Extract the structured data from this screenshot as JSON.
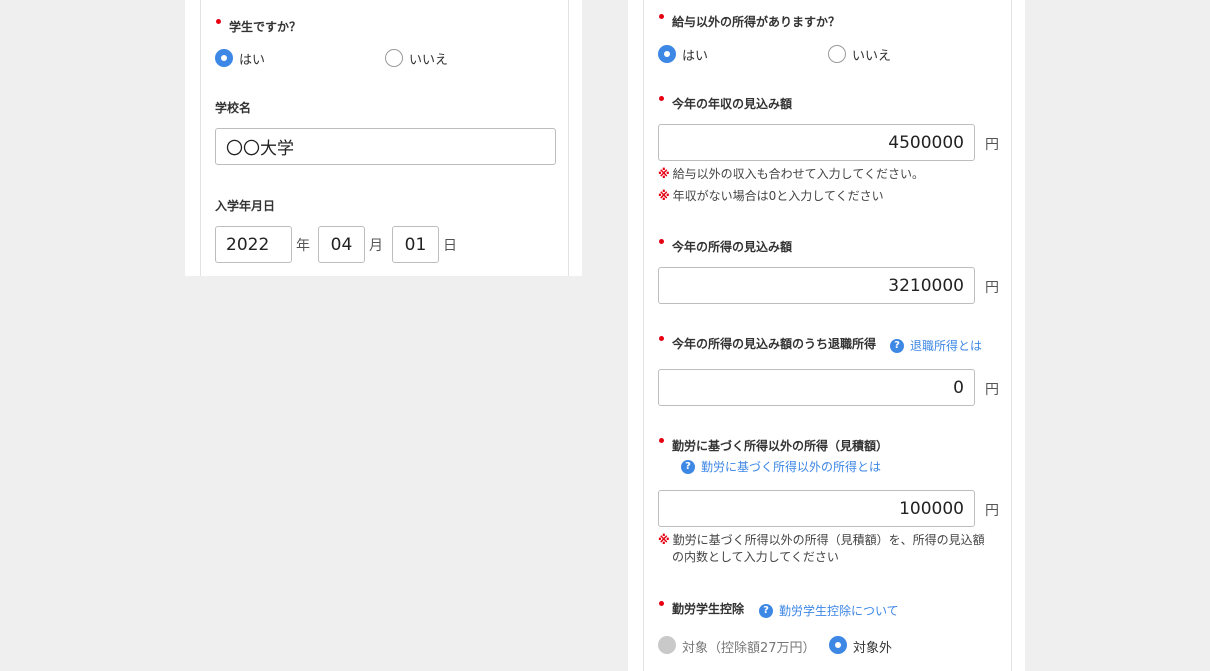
{
  "left": {
    "student_question": {
      "label": "学生ですか？",
      "options": [
        {
          "label": "はい",
          "selected": true
        },
        {
          "label": "いいえ",
          "selected": false
        }
      ]
    },
    "school_name": {
      "label": "学校名",
      "value": "〇〇大学"
    },
    "enrollment_date": {
      "label": "入学年月日",
      "year": "2022",
      "year_unit": "年",
      "month": "04",
      "month_unit": "月",
      "day": "01",
      "day_unit": "日"
    }
  },
  "right": {
    "other_income_question": {
      "label": "給与以外の所得がありますか？",
      "options": [
        {
          "label": "はい",
          "selected": true
        },
        {
          "label": "いいえ",
          "selected": false
        }
      ]
    },
    "annual_income": {
      "label": "今年の年収の見込み額",
      "value": "4500000",
      "unit": "円",
      "notes": [
        {
          "mark": "※",
          "text": "給与以外の収入も合わせて入力してください。"
        },
        {
          "mark": "※",
          "text": "年収がない場合は0と入力してください"
        }
      ]
    },
    "annual_earnings": {
      "label": "今年の所得の見込み額",
      "value": "3210000",
      "unit": "円"
    },
    "retirement_income": {
      "label": "今年の所得の見込み額のうち退職所得",
      "help_icon": "?",
      "help_link": "退職所得とは",
      "value": "0",
      "unit": "円"
    },
    "non_work_income": {
      "label": "勤労に基づく所得以外の所得（見積額）",
      "help_icon": "?",
      "help_link": "勤労に基づく所得以外の所得とは",
      "value": "100000",
      "unit": "円",
      "note_mark": "※",
      "note_line1": "勤労に基づく所得以外の所得（見積額）を、所得の見込額",
      "note_line2": "の内数として入力してください"
    },
    "working_student_deduction": {
      "label": "勤労学生控除",
      "help_icon": "?",
      "help_link": "勤労学生控除について",
      "options": [
        {
          "label": "対象（控除額27万円）",
          "selected": false,
          "disabled": true
        },
        {
          "label": "対象外",
          "selected": true
        }
      ]
    }
  },
  "colors": {
    "accent": "#3d87e5",
    "required": "#e60012",
    "background": "#efefef"
  }
}
